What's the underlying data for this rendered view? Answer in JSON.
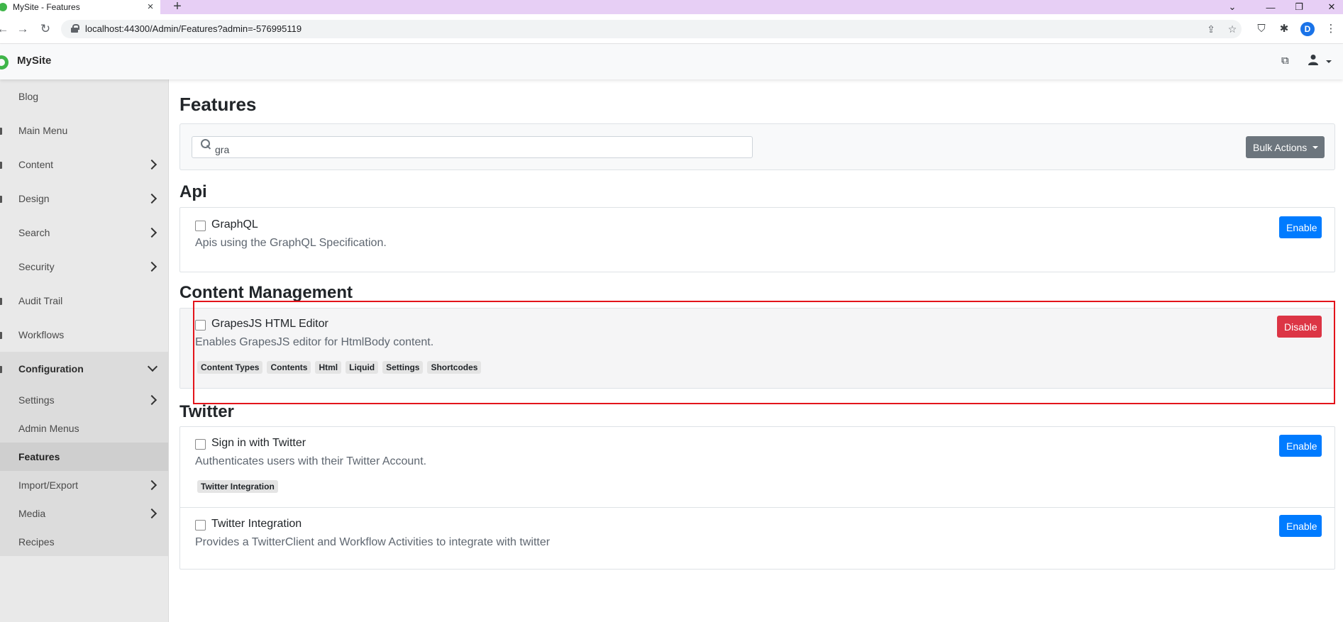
{
  "browser": {
    "tab_title": "MySite - Features",
    "url": "localhost:44300/Admin/Features?admin=-576995119",
    "profile_initial": "D"
  },
  "app": {
    "brand": "MySite"
  },
  "sidebar": {
    "items": [
      {
        "label": "Blog"
      },
      {
        "label": "Main Menu"
      },
      {
        "label": "Content"
      },
      {
        "label": "Design"
      },
      {
        "label": "Search"
      },
      {
        "label": "Security"
      },
      {
        "label": "Audit Trail"
      },
      {
        "label": "Workflows"
      }
    ],
    "configuration": {
      "label": "Configuration",
      "children": [
        {
          "label": "Settings"
        },
        {
          "label": "Admin Menus"
        },
        {
          "label": "Features"
        },
        {
          "label": "Import/Export"
        },
        {
          "label": "Media"
        },
        {
          "label": "Recipes"
        }
      ]
    }
  },
  "main": {
    "title": "Features",
    "search": {
      "value": "gra"
    },
    "bulk_actions": "Bulk Actions",
    "categories": [
      {
        "name": "Api",
        "features": [
          {
            "name": "GraphQL",
            "description": "Apis using the GraphQL Specification.",
            "action": "Enable",
            "tags": []
          }
        ]
      },
      {
        "name": "Content Management",
        "features": [
          {
            "name": "GrapesJS HTML Editor",
            "description": "Enables GrapesJS editor for HtmlBody content.",
            "action": "Disable",
            "tags": [
              "Content Types",
              "Contents",
              "Html",
              "Liquid",
              "Settings",
              "Shortcodes"
            ]
          }
        ]
      },
      {
        "name": "Twitter",
        "features": [
          {
            "name": "Sign in with Twitter",
            "description": "Authenticates users with their Twitter Account.",
            "action": "Enable",
            "tags": [
              "Twitter Integration"
            ]
          },
          {
            "name": "Twitter Integration",
            "description": "Provides a TwitterClient and Workflow Activities to integrate with twitter",
            "action": "Enable",
            "tags": []
          }
        ]
      }
    ]
  },
  "colors": {
    "enable": "#007bff",
    "disable": "#dc3545",
    "secondary": "#6c757d",
    "annotation": "#e3141b",
    "brand": "#3fb549"
  },
  "icons": {
    "tab_close": "×",
    "new_tab": "+",
    "back": "←",
    "forward": "→",
    "reload": "↻",
    "share": "⇪",
    "star": "☆",
    "shield": "⛉",
    "extensions": "✱",
    "menu": "⋮",
    "external": "⧉",
    "user": "👤"
  }
}
